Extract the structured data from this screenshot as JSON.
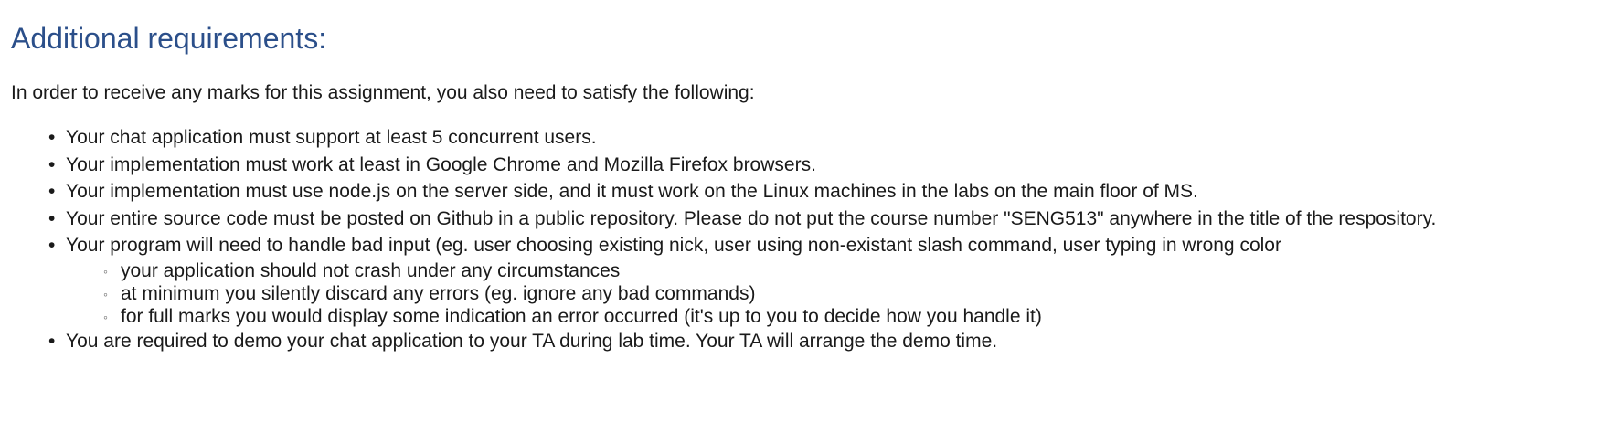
{
  "heading": "Additional requirements:",
  "intro": "In order to receive any marks for this assignment, you also need to satisfy the following:",
  "requirements": [
    {
      "text": "Your chat application must support at least 5 concurrent users."
    },
    {
      "text": "Your implementation must work at least in Google Chrome and Mozilla Firefox browsers."
    },
    {
      "text": "Your implementation must use node.js on the server side, and it must work on the Linux machines in the labs on the main floor of MS."
    },
    {
      "text": "Your entire source code must be posted on Github in a public repository. Please do not put the course number \"SENG513\" anywhere in the title of the respository."
    },
    {
      "text": "Your program will need to handle bad input (eg. user choosing existing nick, user using non-existant slash command, user typing in wrong color",
      "sub_items": [
        "your application should not crash under any circumstances",
        "at minimum you silently discard any errors (eg. ignore any bad commands)",
        "for full marks you would display some indication an error occurred (it's up to you to decide how you handle it)"
      ]
    },
    {
      "text": "You are required to demo your chat application to your TA during lab time. Your TA will arrange the demo time."
    }
  ],
  "colors": {
    "heading": "#2b4f8a",
    "text": "#1a1a1a",
    "background": "#ffffff"
  }
}
